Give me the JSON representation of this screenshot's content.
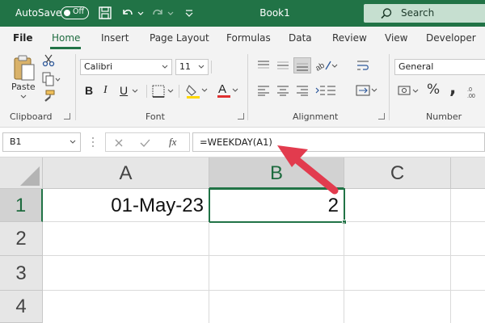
{
  "titlebar": {
    "autosave_label": "AutoSave",
    "autosave_state": "Off",
    "doc_title": "Book1",
    "search_label": "Search"
  },
  "tabs": [
    {
      "label": "File"
    },
    {
      "label": "Home"
    },
    {
      "label": "Insert"
    },
    {
      "label": "Page Layout"
    },
    {
      "label": "Formulas"
    },
    {
      "label": "Data"
    },
    {
      "label": "Review"
    },
    {
      "label": "View"
    },
    {
      "label": "Developer"
    }
  ],
  "ribbon": {
    "clipboard": {
      "label": "Clipboard",
      "paste_label": "Paste"
    },
    "font": {
      "label": "Font",
      "font_name": "Calibri",
      "font_size": "11"
    },
    "alignment": {
      "label": "Alignment"
    },
    "number": {
      "label": "Number",
      "format": "General",
      "percent": "%"
    }
  },
  "formula_bar": {
    "name_box": "B1",
    "formula": "=WEEKDAY(A1)"
  },
  "grid": {
    "columns": [
      "A",
      "B",
      "C"
    ],
    "rows": [
      "1",
      "2",
      "3",
      "4"
    ],
    "cells": {
      "A1": "01-May-23",
      "B1": "2"
    }
  },
  "colors": {
    "accent": "#217346",
    "arrow": "#e23b4e"
  }
}
